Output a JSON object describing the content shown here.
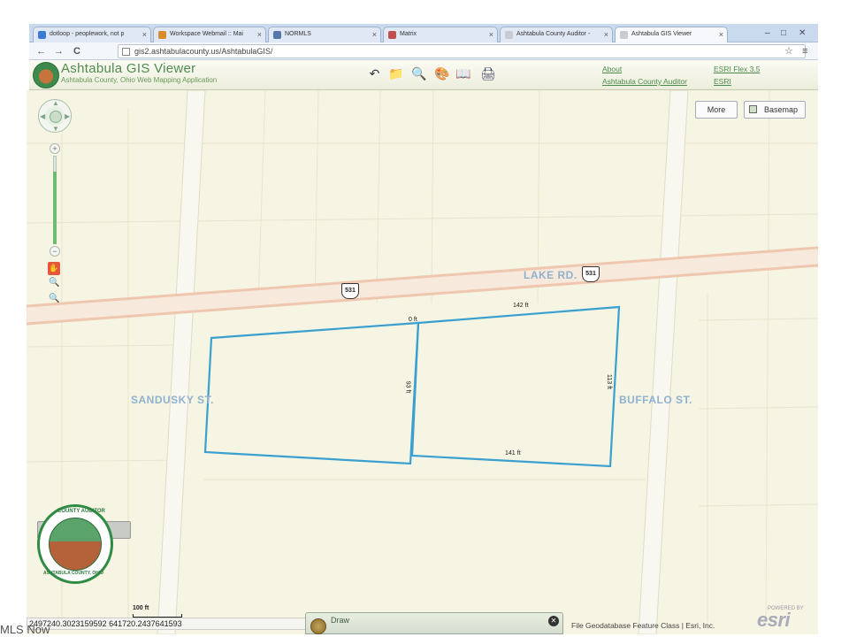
{
  "browser": {
    "tabs": [
      {
        "label": "dotloop - peoplework, not p",
        "color": "#3b7bd6"
      },
      {
        "label": "Workspace Webmail :: Mai",
        "color": "#d98c2b"
      },
      {
        "label": "NORMLS",
        "color": "#5577aa"
      },
      {
        "label": "Matrix",
        "color": "#c0504d"
      },
      {
        "label": "Ashtabula County Auditor -",
        "color": "#7f8c8d"
      },
      {
        "label": "Ashtabula GIS Viewer",
        "color": "#7f8c8d"
      }
    ],
    "window_controls": [
      "–",
      "□",
      "✕"
    ],
    "url": "gis2.ashtabulacounty.us/AshtabulaGIS/",
    "back_icon": "←",
    "forward_icon": "→",
    "reload_icon": "C",
    "star_icon": "☆",
    "menu_icon": "≡"
  },
  "app": {
    "title": "Ashtabula GIS Viewer",
    "subtitle": "Ashtabula County, Ohio Web Mapping Application",
    "links": {
      "about": "About",
      "auditor": "Ashtabula County Auditor",
      "flex": "ESRI Flex 3.5",
      "esri": "ESRI"
    },
    "tools": [
      "↶",
      "📁",
      "🔍",
      "🎨",
      "📖",
      "🖨"
    ]
  },
  "map": {
    "buttons": {
      "more": "More",
      "basemap": "Basemap"
    },
    "streets": {
      "lake_rd": "LAKE RD.",
      "sandusky": "SANDUSKY ST.",
      "buffalo": "BUFFALO ST."
    },
    "route_shields": [
      "531",
      "531"
    ],
    "dimensions": {
      "top_left": "0 ft",
      "top_right": "142 ft",
      "middle_side": "93 ft",
      "right_side": "113 ft",
      "bottom": "141 ft"
    },
    "nav": {
      "zoom_in": "+",
      "zoom_out": "−",
      "hand": "✋",
      "magnify": "🔍"
    },
    "scale_label": "100 ft",
    "coordinates": "2497240.3023159592 641720.2437641593",
    "draw_panel": {
      "title": "Draw"
    },
    "attribution": "File Geodatabase Feature Class | Esri, Inc.",
    "esri_logo": "esri",
    "esri_small": "POWERED BY",
    "overview_ring": "COUNTY AUDITOR",
    "overview_ring_bottom": "ASHTABULA COUNTY, OHIO"
  },
  "watermark": "MLS Now",
  "colors": {
    "parcel": "#3aa0d0",
    "road": "#efcab2",
    "street_label": "#8fb2cf",
    "header_green": "#4f8a4f"
  }
}
